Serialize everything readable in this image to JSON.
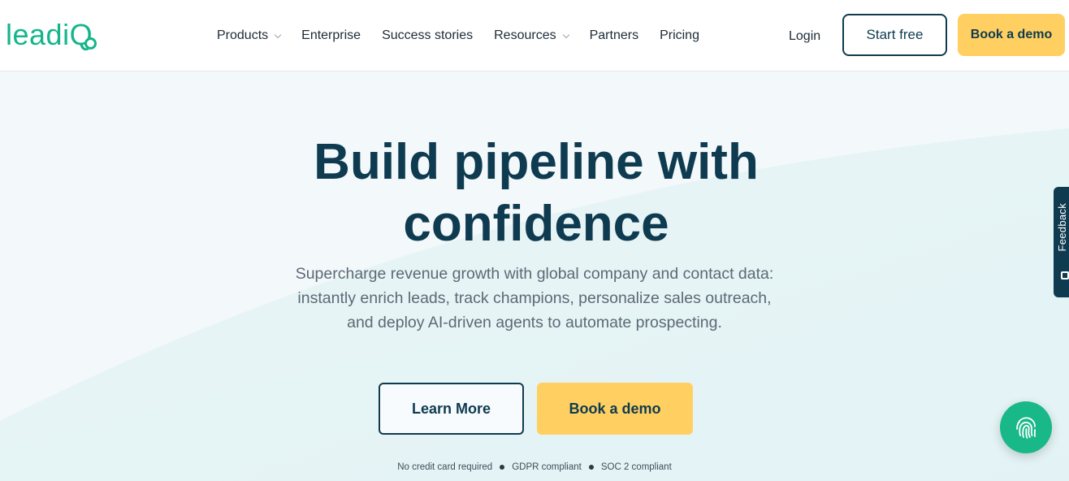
{
  "brand": {
    "logo_text": "leadi",
    "logo_q": "Q",
    "accent_color": "#15b58c",
    "cta_color": "#ffd061",
    "text_color": "#0f3b50"
  },
  "nav": {
    "items": [
      {
        "label": "Products",
        "has_dropdown": true
      },
      {
        "label": "Enterprise",
        "has_dropdown": false
      },
      {
        "label": "Success stories",
        "has_dropdown": false
      },
      {
        "label": "Resources",
        "has_dropdown": true
      },
      {
        "label": "Partners",
        "has_dropdown": false
      },
      {
        "label": "Pricing",
        "has_dropdown": false
      }
    ],
    "login_label": "Login",
    "start_free_label": "Start free",
    "book_demo_label": "Book a demo"
  },
  "hero": {
    "headline_line1": "Build pipeline with",
    "headline_line2": "confidence",
    "subtext": "Supercharge revenue growth with global company and contact data: instantly enrich leads, track champions, personalize sales outreach, and deploy AI-driven agents to automate prospecting.",
    "learn_more_label": "Learn More",
    "book_demo_label": "Book a demo",
    "badges": [
      "No credit card required",
      "GDPR compliant",
      "SOC 2 compliant"
    ]
  },
  "feedback": {
    "label": "Feedback",
    "icon": "feedback-icon"
  },
  "chat": {
    "icon": "fingerprint-icon"
  }
}
